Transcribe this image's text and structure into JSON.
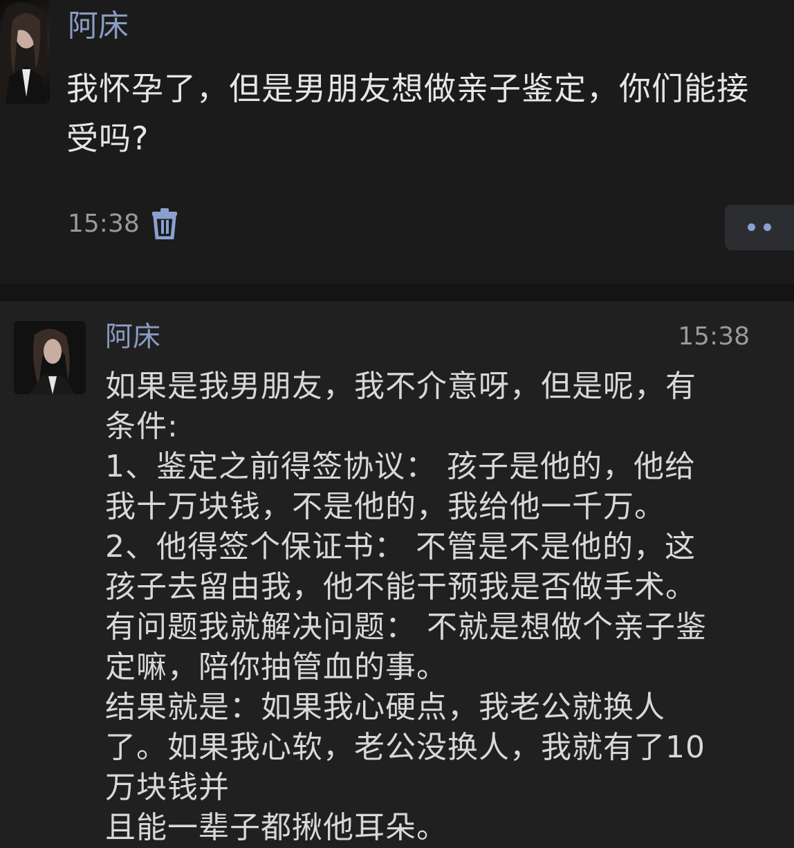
{
  "post": {
    "author": "阿床",
    "text": "我怀孕了，但是男朋友想做亲子鉴定，你们能接受吗?",
    "time": "15:38",
    "avatar_icon": "woman-portrait-avatar",
    "delete_icon": "trash-icon",
    "more_icon": "more-dots-icon"
  },
  "comment": {
    "author": "阿床",
    "time": "15:38",
    "avatar_icon": "woman-portrait-avatar",
    "lines": [
      "如果是我男朋友，我不介意呀，但是呢，有",
      "条件:",
      "1、鉴定之前得签协议： 孩子是他的，他给",
      "我十万块钱，不是他的，我给他一千万。",
      "2、他得签个保证书： 不管是不是他的，这",
      "孩子去留由我，他不能干预我是否做手术。",
      "有问题我就解决问题： 不就是想做个亲子鉴",
      "定嘛，陪你抽管血的事。",
      "结果就是：如果我心硬点，我老公就换人",
      "了。如果我心软，老公没换人，我就有了10",
      "万块钱并",
      "且能一辈子都揪他耳朵。"
    ]
  },
  "colors": {
    "name": "#8a9bc4",
    "text": "#e6e6e6",
    "meta": "#9a9a9a",
    "accent_dot": "#8aa0cf"
  }
}
